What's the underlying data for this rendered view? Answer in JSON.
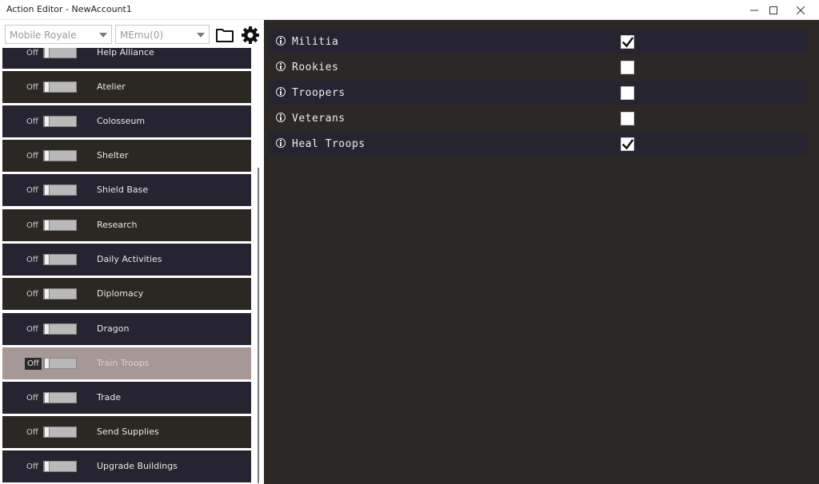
{
  "window": {
    "title": "Action Editor - NewAccount1",
    "minimize_icon": "minimize-icon",
    "maximize_icon": "maximize-icon",
    "close_icon": "close-icon"
  },
  "toolbar": {
    "game_select": {
      "value": "Mobile Royale"
    },
    "emulator_select": {
      "value": "MEmu(0)"
    },
    "folder_icon": "folder-icon",
    "settings_icon": "gear-icon"
  },
  "actions": [
    {
      "label": "Help Alliance",
      "state": "Off",
      "selected": false
    },
    {
      "label": "Atelier",
      "state": "Off",
      "selected": false
    },
    {
      "label": "Colosseum",
      "state": "Off",
      "selected": false
    },
    {
      "label": "Shelter",
      "state": "Off",
      "selected": false
    },
    {
      "label": "Shield Base",
      "state": "Off",
      "selected": false
    },
    {
      "label": "Research",
      "state": "Off",
      "selected": false
    },
    {
      "label": "Daily Activities",
      "state": "Off",
      "selected": false
    },
    {
      "label": "Diplomacy",
      "state": "Off",
      "selected": false
    },
    {
      "label": "Dragon",
      "state": "Off",
      "selected": false
    },
    {
      "label": "Train Troops",
      "state": "Off",
      "selected": true
    },
    {
      "label": "Trade",
      "state": "Off",
      "selected": false
    },
    {
      "label": "Send Supplies",
      "state": "Off",
      "selected": false
    },
    {
      "label": "Upgrade Buildings",
      "state": "Off",
      "selected": false
    }
  ],
  "options": [
    {
      "label": "Militia",
      "checked": true
    },
    {
      "label": "Rookies",
      "checked": false
    },
    {
      "label": "Troopers",
      "checked": false
    },
    {
      "label": "Veterans",
      "checked": false
    },
    {
      "label": "Heal Troops",
      "checked": true
    }
  ],
  "colors": {
    "background": "#2b2826",
    "row_dark": "#262430",
    "row_brown": "#2b2723",
    "selected": "#a79898"
  }
}
